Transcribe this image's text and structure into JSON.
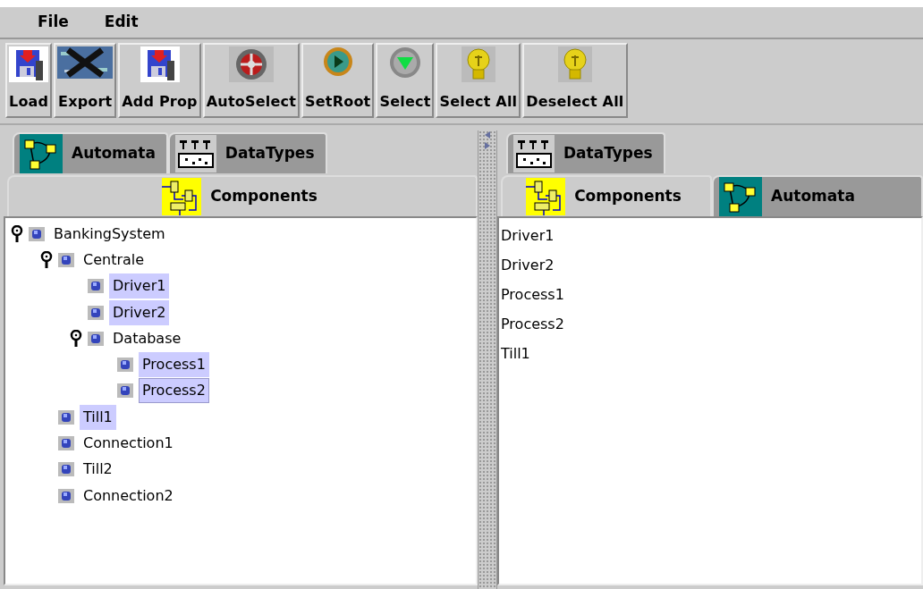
{
  "menu": [
    "File",
    "Edit"
  ],
  "toolbar": [
    {
      "label": "Load",
      "kind": "floppy"
    },
    {
      "label": "Export",
      "kind": "export"
    },
    {
      "label": "Add Prop",
      "kind": "floppy"
    },
    {
      "label": "AutoSelect",
      "kind": "hazard"
    },
    {
      "label": "SetRoot",
      "kind": "play"
    },
    {
      "label": "Select",
      "kind": "down"
    },
    {
      "label": "Select All",
      "kind": "bulb"
    },
    {
      "label": "Deselect All",
      "kind": "bulb"
    }
  ],
  "left_panel": {
    "tab_rows": [
      [
        {
          "label": "Automata",
          "kind": "automata",
          "selected": false
        },
        {
          "label": "DataTypes",
          "kind": "datatypes",
          "selected": false
        }
      ],
      [
        {
          "label": "Components",
          "kind": "components",
          "selected": true
        }
      ]
    ],
    "tree": [
      {
        "label": "BankingSystem",
        "expanded": true,
        "selected": false,
        "focused": false,
        "children": [
          {
            "label": "Centrale",
            "expanded": true,
            "selected": false,
            "focused": false,
            "children": [
              {
                "label": "Driver1",
                "selected": true,
                "focused": false
              },
              {
                "label": "Driver2",
                "selected": true,
                "focused": false
              },
              {
                "label": "Database",
                "expanded": true,
                "selected": false,
                "focused": false,
                "children": [
                  {
                    "label": "Process1",
                    "selected": true,
                    "focused": false
                  },
                  {
                    "label": "Process2",
                    "selected": true,
                    "focused": true
                  }
                ]
              }
            ]
          },
          {
            "label": "Till1",
            "selected": true,
            "focused": false
          },
          {
            "label": "Connection1",
            "selected": false,
            "focused": false
          },
          {
            "label": "Till2",
            "selected": false,
            "focused": false
          },
          {
            "label": "Connection2",
            "selected": false,
            "focused": false
          }
        ]
      }
    ]
  },
  "right_panel": {
    "tab_rows": [
      [
        {
          "label": "DataTypes",
          "kind": "datatypes",
          "selected": false
        }
      ],
      [
        {
          "label": "Components",
          "kind": "components",
          "selected": true
        },
        {
          "label": "Automata",
          "kind": "automata",
          "selected": false
        }
      ]
    ],
    "list": [
      "Driver1",
      "Driver2",
      "Process1",
      "Process2",
      "Till1"
    ]
  }
}
